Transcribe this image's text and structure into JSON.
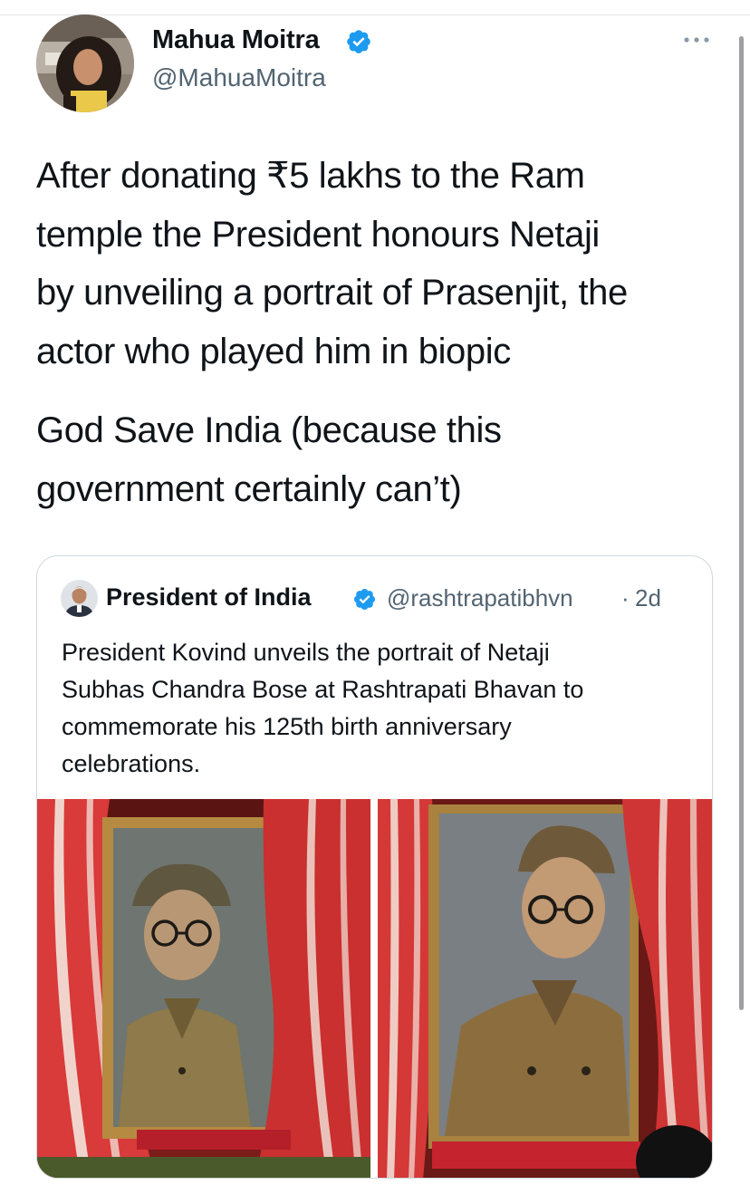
{
  "tweet": {
    "author_name": "Mahua Moitra",
    "author_handle": "@MahuaMoitra",
    "author_verified": true,
    "paragraphs": [
      "After donating ₹5 lakhs to the Ram\ntemple the President honours Netaji\nby unveiling a portrait of Prasenjit, the\nactor who played him in biopic",
      "God Save India (because this\ngovernment certainly can’t)"
    ]
  },
  "quoted_tweet": {
    "author_name": "President of India",
    "author_handle": "@rashtrapatibhvn",
    "separator": "·",
    "time": "2d",
    "verified": true,
    "text": "President Kovind unveils the portrait of Netaji\nSubhas Chandra Bose at Rashtrapati Bhavan to\ncommemorate his 125th birth anniversary\ncelebrations.",
    "images": [
      "portrait-left-photo",
      "portrait-right-photo"
    ]
  },
  "icons": {
    "more": "more-horizontal-icon",
    "verified": "verified-badge-icon"
  },
  "colors": {
    "verified": "#1d9bf0",
    "text": "#0f1419",
    "secondary": "#536471",
    "border": "#cfd9de"
  }
}
